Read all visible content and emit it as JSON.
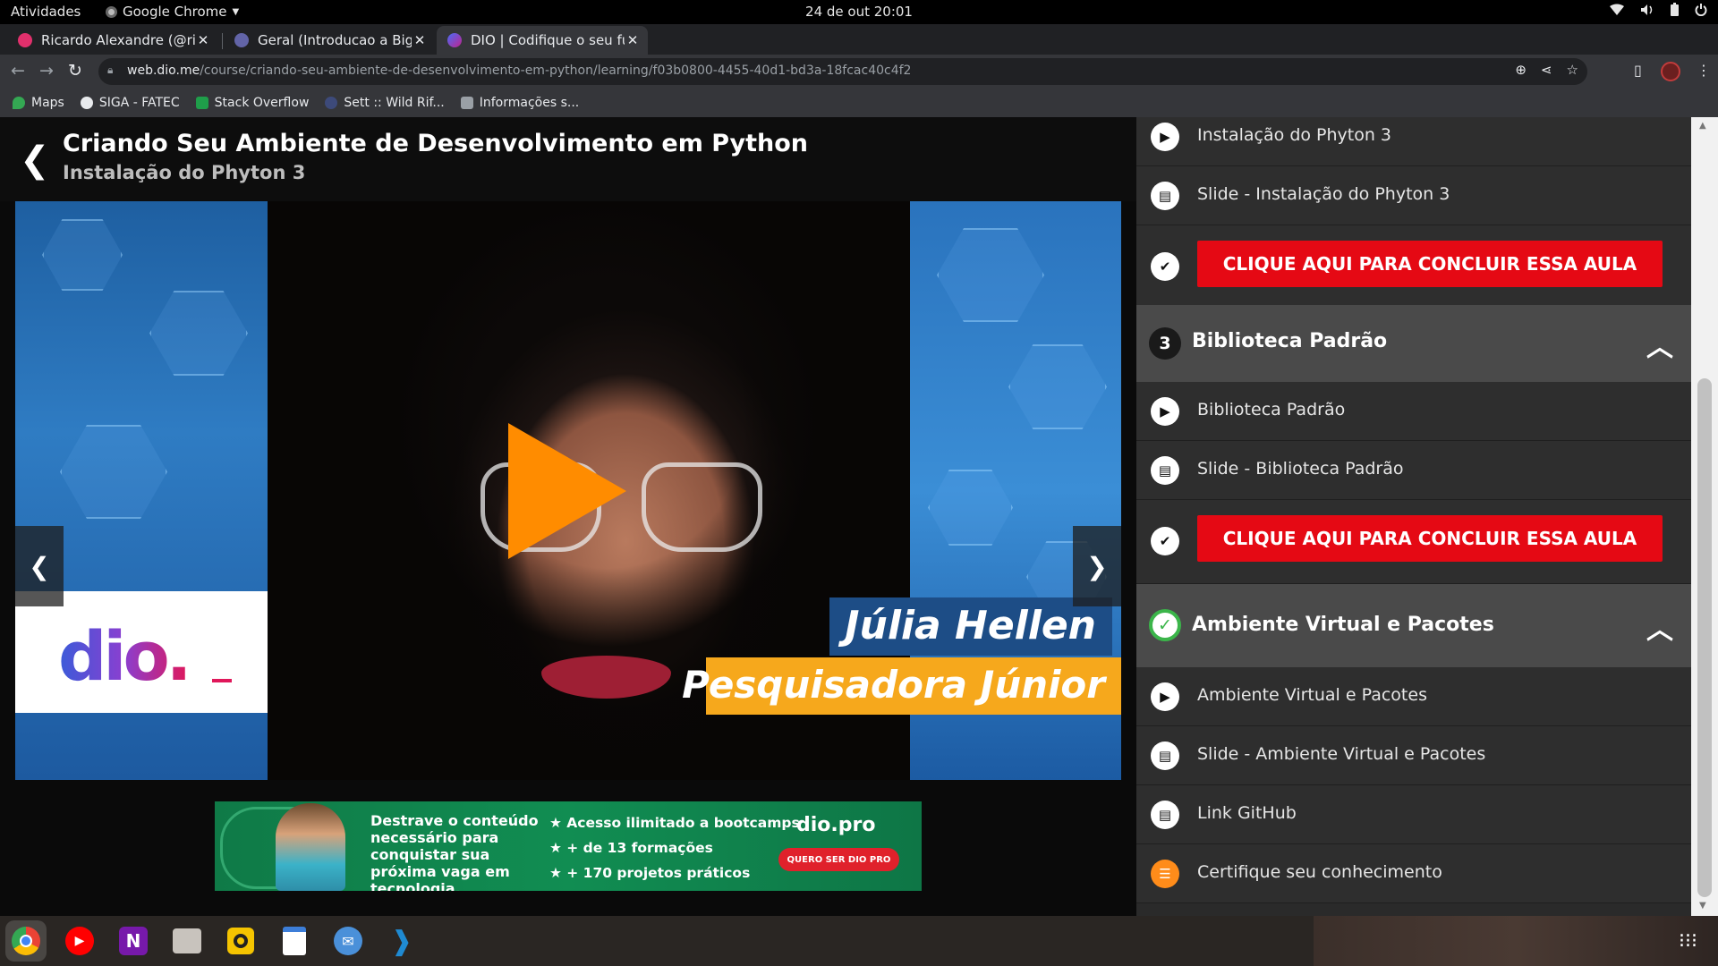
{
  "topbar": {
    "activities": "Atividades",
    "app_name": "Google Chrome",
    "clock": "24 de out  20:01"
  },
  "tabs": [
    {
      "title": "Ricardo Alexandre (@rica",
      "color": "#e1306c"
    },
    {
      "title": "Geral (Introducao a Big D",
      "color": "#6264a7"
    },
    {
      "title": "DIO | Codifique o seu futu",
      "color": "#4a6cf7"
    }
  ],
  "toolbar": {
    "url_host": "web.dio.me",
    "url_path": "/course/criando-seu-ambiente-de-desenvolvimento-em-python/learning/f03b0800-4455-40d1-bd3a-18fcac40c4f2"
  },
  "bookmarks": [
    {
      "label": "Maps",
      "color": "#34a853"
    },
    {
      "label": "SIGA - FATEC",
      "color": "#e8eaed"
    },
    {
      "label": "Stack Overflow",
      "color": "#1f9e4a"
    },
    {
      "label": "Sett :: Wild Rif...",
      "color": "#3d4a7a"
    },
    {
      "label": "Informações s...",
      "color": "#9aa0a6"
    }
  ],
  "page": {
    "course_title": "Criando Seu Ambiente de Desenvolvimento em Python",
    "lesson_subtitle": "Instalação do Phyton 3"
  },
  "video": {
    "logo": "dio.",
    "name": "Júlia Hellen",
    "role": "Pesquisadora Júnior"
  },
  "banner": {
    "text": "Destrave o conteúdo necessário para conquistar sua próxima vaga em tecnologia.",
    "bullets": [
      "Acesso ilimitado a bootcamps",
      "+ de 13 formações",
      "+ 170 projetos práticos"
    ],
    "logo": "dio.pro",
    "cta": "QUERO SER DIO PRO"
  },
  "sidebar": {
    "items_top": [
      {
        "label": "Instalação do Phyton 3",
        "type": "play"
      },
      {
        "label": "Slide - Instalação do Phyton 3",
        "type": "doc"
      }
    ],
    "cta_label": "CLIQUE AQUI PARA CONCLUIR ESSA AULA",
    "section3": {
      "number": "3",
      "title": "Biblioteca Padrão"
    },
    "items_section3": [
      {
        "label": "Biblioteca Padrão",
        "type": "play"
      },
      {
        "label": "Slide - Biblioteca Padrão",
        "type": "doc"
      }
    ],
    "section4": {
      "title": "Ambiente Virtual e Pacotes"
    },
    "items_section4": [
      {
        "label": "Ambiente Virtual e Pacotes",
        "type": "play"
      },
      {
        "label": "Slide - Ambiente Virtual e Pacotes",
        "type": "doc"
      },
      {
        "label": "Link GitHub",
        "type": "doc"
      },
      {
        "label": "Certifique seu conhecimento",
        "type": "quiz"
      }
    ]
  },
  "dock": [
    {
      "name": "chrome",
      "color": "#4285f4"
    },
    {
      "name": "youtube-music",
      "color": "#ff0000"
    },
    {
      "name": "onenote",
      "color": "#7719aa"
    },
    {
      "name": "files",
      "color": "#c8c3bd"
    },
    {
      "name": "rhythmbox",
      "color": "#f5c400"
    },
    {
      "name": "text-editor",
      "color": "#3d7ed8"
    },
    {
      "name": "mail",
      "color": "#4a90d9"
    },
    {
      "name": "vscode",
      "color": "#1f8ad2"
    }
  ]
}
